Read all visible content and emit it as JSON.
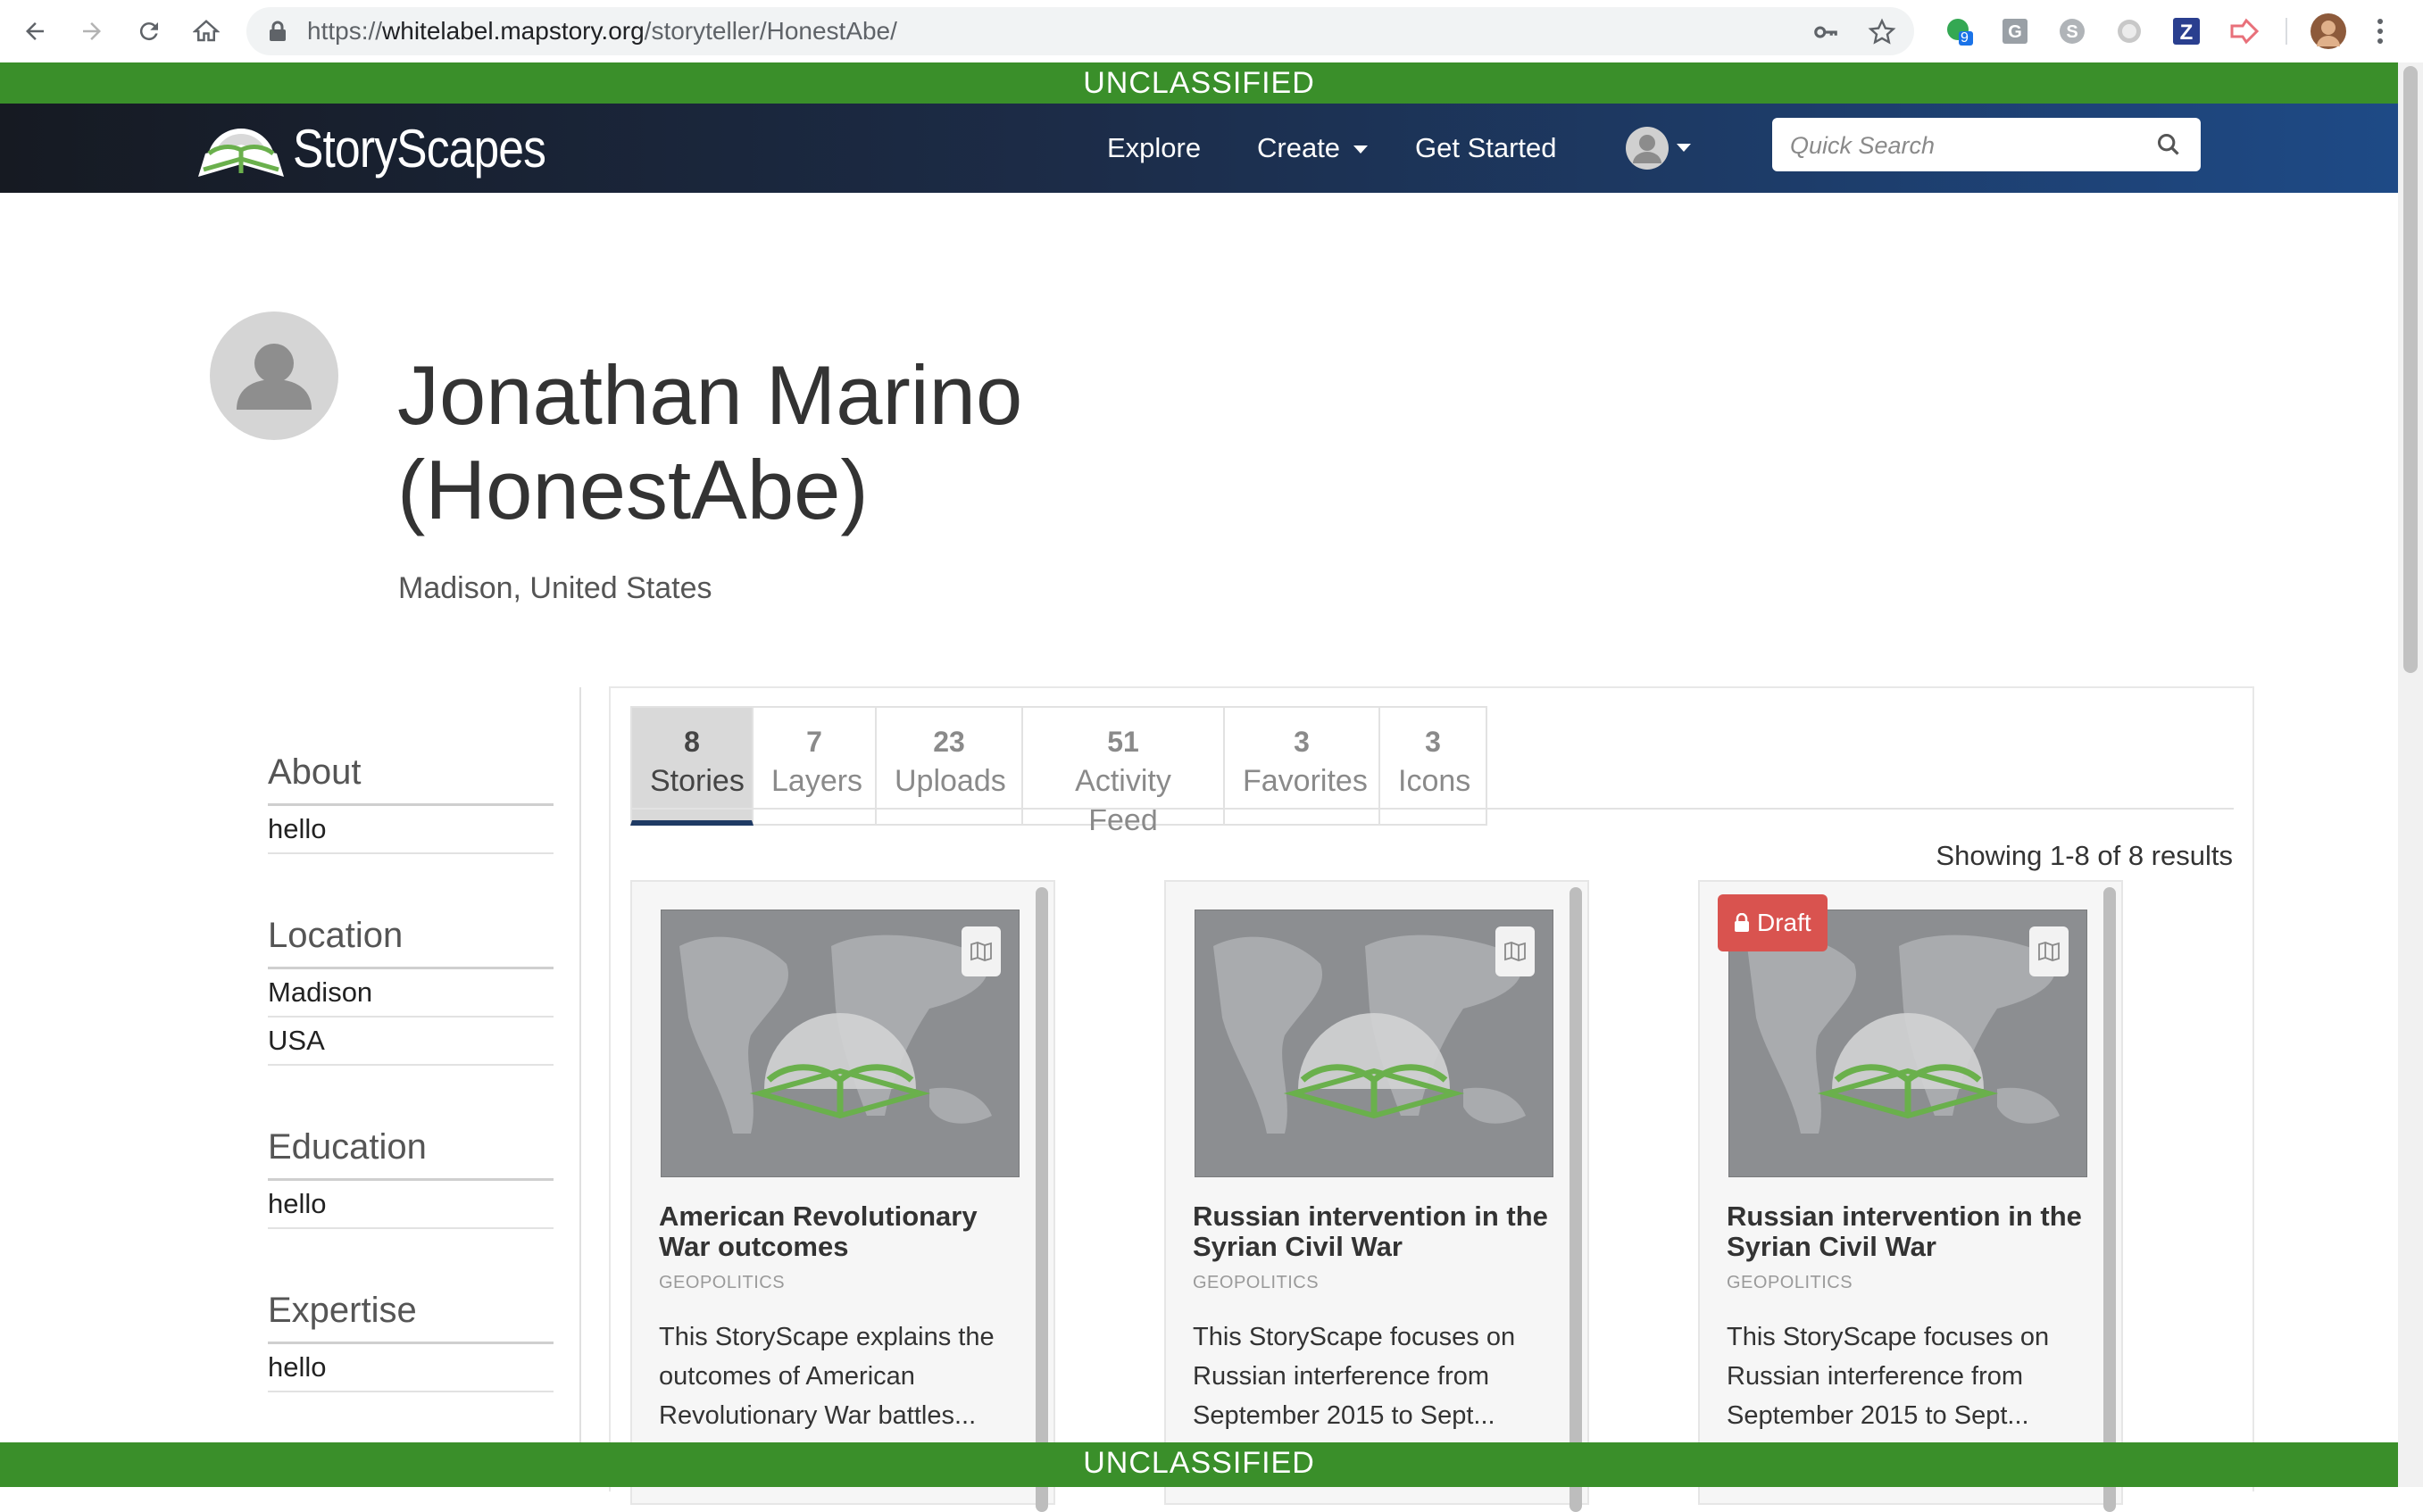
{
  "browser": {
    "url_prefix": "https://",
    "url_host": "whitelabel.mapstory.org",
    "url_path": "/storyteller/HonestAbe/",
    "extension_badge": "9"
  },
  "classification": {
    "top": "UNCLASSIFIED",
    "bottom": "UNCLASSIFIED"
  },
  "site": {
    "brand": "StoryScapes",
    "nav": {
      "explore": "Explore",
      "create": "Create",
      "get_started": "Get Started"
    },
    "search_placeholder": "Quick Search"
  },
  "profile": {
    "name_line1": "Jonathan Marino",
    "name_line2": "(HonestAbe)",
    "location": "Madison, United States"
  },
  "sidebar": {
    "about": {
      "heading": "About",
      "items": [
        "hello"
      ]
    },
    "location": {
      "heading": "Location",
      "items": [
        "Madison",
        "USA"
      ]
    },
    "education": {
      "heading": "Education",
      "items": [
        "hello"
      ]
    },
    "expertise": {
      "heading": "Expertise",
      "items": [
        "hello"
      ]
    }
  },
  "tabs": [
    {
      "count": "8",
      "label": "Stories"
    },
    {
      "count": "7",
      "label": "Layers"
    },
    {
      "count": "23",
      "label": "Uploads"
    },
    {
      "count": "51",
      "label": "Activity Feed"
    },
    {
      "count": "3",
      "label": "Favorites"
    },
    {
      "count": "3",
      "label": "Icons"
    }
  ],
  "results_text": "Showing 1-8 of 8 results",
  "cards": [
    {
      "title": "American Revolutionary War outcomes",
      "category": "GEOPOLITICS",
      "description": "This StoryScape explains the outcomes of American Revolutionary War battles..."
    },
    {
      "title": "Russian intervention in the Syrian Civil War",
      "category": "GEOPOLITICS",
      "description": "This StoryScape focuses on Russian interference from September 2015 to Sept..."
    },
    {
      "title": "Russian intervention in the Syrian Civil War",
      "category": "GEOPOLITICS",
      "description": "This StoryScape focuses on Russian interference from September 2015 to Sept...",
      "badge": "Draft"
    }
  ],
  "colors": {
    "classification_green": "#3a8f2a",
    "nav_dark": "#161a22",
    "nav_blue": "#1e4a86",
    "tab_active_underline": "#1f3a64",
    "draft_red": "#d9534f",
    "logo_green": "#6ab04c"
  }
}
